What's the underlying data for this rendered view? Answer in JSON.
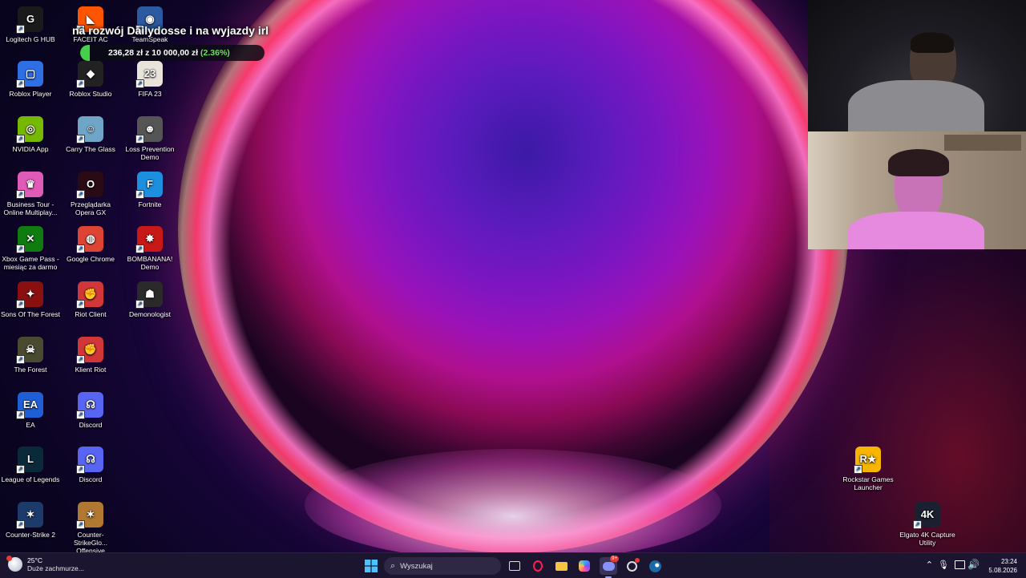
{
  "overlay": {
    "title": "na rozwój Dailydosse i na wyjazdy irl",
    "donation_text": "236,28 zł  z  10 000,00 zł",
    "donation_pct": "(2.36%)",
    "progress_fraction": 0.0236
  },
  "desktop_icons": [
    {
      "label": "Logitech G HUB",
      "icon": "logitech-g-icon",
      "glyph": "G",
      "color": "#1a1a1a"
    },
    {
      "label": "FACEIT AC",
      "icon": "faceit-icon",
      "glyph": "◣",
      "color": "#ff5500"
    },
    {
      "label": "TeamSpeak",
      "icon": "teamspeak-icon",
      "glyph": "◉",
      "color": "#2c5aa0"
    },
    {
      "label": "Roblox Player",
      "icon": "roblox-player-icon",
      "glyph": "▢",
      "color": "#2f6fe4"
    },
    {
      "label": "Roblox Studio",
      "icon": "roblox-studio-icon",
      "glyph": "◆",
      "color": "#222"
    },
    {
      "label": "FIFA 23",
      "icon": "fifa-icon",
      "glyph": "23",
      "color": "#e8e4da"
    },
    {
      "label": "NVIDIA App",
      "icon": "nvidia-icon",
      "glyph": "◎",
      "color": "#76b900"
    },
    {
      "label": "Carry The Glass",
      "icon": "carry-the-glass-icon",
      "glyph": "☺",
      "color": "#6fa6c8"
    },
    {
      "label": "Loss Prevention Demo",
      "icon": "loss-prevention-icon",
      "glyph": "☻",
      "color": "#555"
    },
    {
      "label": "Business Tour - Online Multiplay...",
      "icon": "business-tour-icon",
      "glyph": "♛",
      "color": "#e05ab8"
    },
    {
      "label": "Przeglądarka Opera GX",
      "icon": "opera-gx-icon",
      "glyph": "O",
      "color": "#2a0a14"
    },
    {
      "label": "Fortnite",
      "icon": "fortnite-icon",
      "glyph": "F",
      "color": "#1d8fe0"
    },
    {
      "label": "Xbox Game Pass - miesiąc za darmo",
      "icon": "xbox-icon",
      "glyph": "✕",
      "color": "#107c10"
    },
    {
      "label": "Google Chrome",
      "icon": "chrome-icon",
      "glyph": "◍",
      "color": "#dd4433"
    },
    {
      "label": "BOMBANANA! Demo",
      "icon": "bombanana-icon",
      "glyph": "✸",
      "color": "#c81818"
    },
    {
      "label": "Sons Of The Forest",
      "icon": "sons-of-the-forest-icon",
      "glyph": "✦",
      "color": "#8a1010"
    },
    {
      "label": "Riot Client",
      "icon": "riot-client-icon",
      "glyph": "✊",
      "color": "#d13639"
    },
    {
      "label": "Demonologist",
      "icon": "demonologist-icon",
      "glyph": "☗",
      "color": "#2a2a2a"
    },
    {
      "label": "The Forest",
      "icon": "the-forest-icon",
      "glyph": "☠",
      "color": "#4a4a30"
    },
    {
      "label": "Klient Riot",
      "icon": "klient-riot-icon",
      "glyph": "✊",
      "color": "#d13639"
    },
    {
      "label": "EA",
      "icon": "ea-icon",
      "glyph": "EA",
      "color": "#1f5fd6"
    },
    {
      "label": "Discord",
      "icon": "discord-icon",
      "glyph": "☊",
      "color": "#5865f2"
    },
    {
      "label": "League of Legends",
      "icon": "league-of-legends-icon",
      "glyph": "L",
      "color": "#0a2a3a"
    },
    {
      "label": "Discord",
      "icon": "discord-icon",
      "glyph": "☊",
      "color": "#5865f2"
    },
    {
      "label": "Counter-Strike 2",
      "icon": "cs2-icon",
      "glyph": "✶",
      "color": "#1c3b6a"
    },
    {
      "label": "Counter-StrikeGlo... Offensive",
      "icon": "csgo-icon",
      "glyph": "✶",
      "color": "#b07830"
    },
    {
      "label": "Rockstar Games Launcher",
      "icon": "rockstar-icon",
      "glyph": "R★",
      "color": "#f7b500"
    },
    {
      "label": "Elgato 4K Capture Utility",
      "icon": "elgato-icon",
      "glyph": "4K",
      "color": "#1a2030"
    }
  ],
  "taskbar": {
    "weather_temp": "25°C",
    "weather_desc": "Duże zachmurze...",
    "search_placeholder": "Wyszukaj",
    "clock_time": "23:24",
    "clock_date": "5.08.2026",
    "discord_badge": "9+"
  }
}
